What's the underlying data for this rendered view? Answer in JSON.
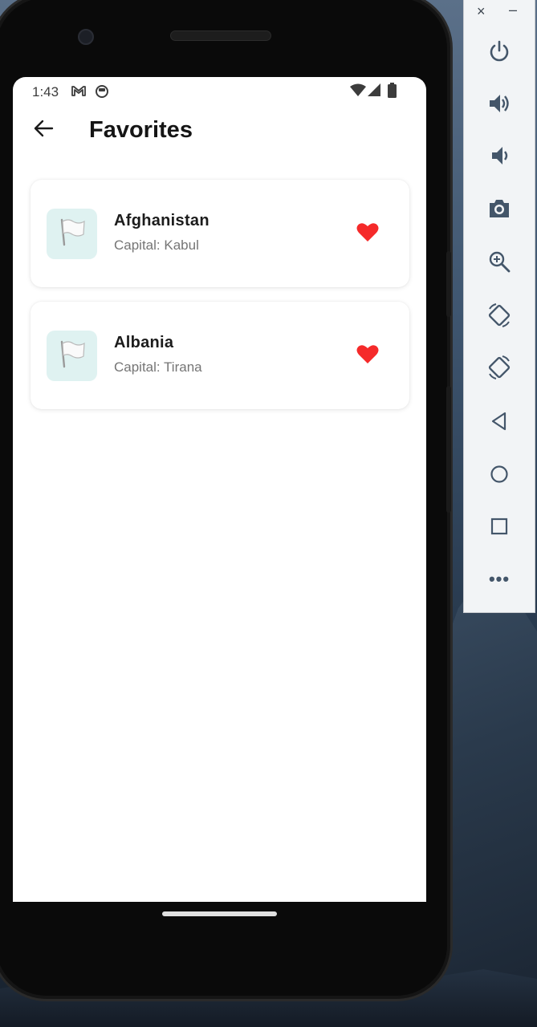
{
  "status_bar": {
    "time": "1:43",
    "icons": [
      "gmail-icon",
      "sync-icon",
      "wifi-icon",
      "signal-icon",
      "battery-icon"
    ]
  },
  "app_bar": {
    "title": "Favorites",
    "back_icon": "arrow-back-icon"
  },
  "favorites": [
    {
      "name": "Afghanistan",
      "capital": "Capital: Kabul",
      "flag_icon": "white-flag-icon",
      "favorite_icon": "heart-icon"
    },
    {
      "name": "Albania",
      "capital": "Capital: Tirana",
      "flag_icon": "white-flag-icon",
      "favorite_icon": "heart-icon"
    }
  ],
  "emulator_toolbar": {
    "close_label": "×",
    "minimize_label": "–",
    "more_label": "•••",
    "buttons": [
      "power-icon",
      "volume-up-icon",
      "volume-down-icon",
      "camera-icon",
      "zoom-icon",
      "rotate-left-icon",
      "rotate-right-icon",
      "back-nav-icon",
      "home-nav-icon",
      "overview-nav-icon",
      "more-icon"
    ]
  },
  "colors": {
    "heart": "#f52a2a",
    "flag_background": "#dff2f1",
    "toolbar_icon": "#44566a"
  }
}
